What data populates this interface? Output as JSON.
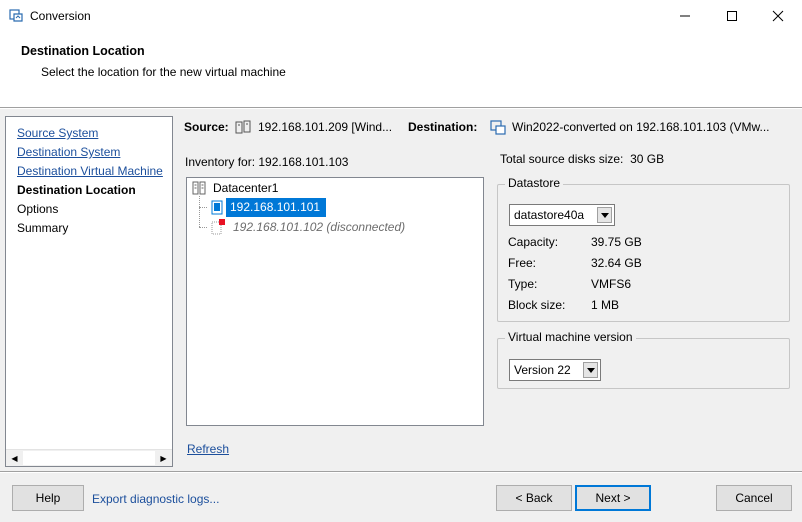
{
  "window": {
    "title": "Conversion",
    "icon": "converter-app-icon",
    "controls": [
      "minimize-icon",
      "maximize-icon",
      "close-icon"
    ]
  },
  "header": {
    "title": "Destination Location",
    "subtitle": "Select the location for the new virtual machine"
  },
  "nav": {
    "items": [
      {
        "label": "Source System",
        "state": "link"
      },
      {
        "label": "Destination System",
        "state": "link"
      },
      {
        "label": "Destination Virtual Machine",
        "state": "link"
      },
      {
        "label": "Destination Location",
        "state": "current"
      },
      {
        "label": "Options",
        "state": "pending"
      },
      {
        "label": "Summary",
        "state": "pending"
      }
    ]
  },
  "summary_bar": {
    "source_label": "Source:",
    "source_value": "192.168.101.209 [Wind...",
    "destination_label": "Destination:",
    "destination_value": "Win2022-converted on 192.168.101.103 (VMw..."
  },
  "inventory": {
    "label": "Inventory for:",
    "host": "192.168.101.103",
    "tree": {
      "root": "Datacenter1",
      "children": [
        {
          "label": "192.168.101.101",
          "selected": true,
          "disconnected": false
        },
        {
          "label": "192.168.101.102 (disconnected)",
          "selected": false,
          "disconnected": true
        }
      ]
    },
    "refresh_label": "Refresh"
  },
  "right_panel": {
    "total_disks_label": "Total source disks size:",
    "total_disks_value": "30 GB",
    "datastore": {
      "legend": "Datastore",
      "selected": "datastore40a",
      "capacity_label": "Capacity:",
      "capacity_value": "39.75 GB",
      "free_label": "Free:",
      "free_value": "32.64 GB",
      "type_label": "Type:",
      "type_value": "VMFS6",
      "block_label": "Block size:",
      "block_value": "1 MB"
    },
    "vm_version": {
      "legend": "Virtual machine version",
      "selected": "Version 22"
    }
  },
  "footer": {
    "help": "Help",
    "export": "Export diagnostic logs...",
    "back": "< Back",
    "next": "Next >",
    "cancel": "Cancel"
  },
  "colors": {
    "selection": "#0078d7",
    "link": "#1c4f9c",
    "disconnected_badge": "#e81123"
  }
}
